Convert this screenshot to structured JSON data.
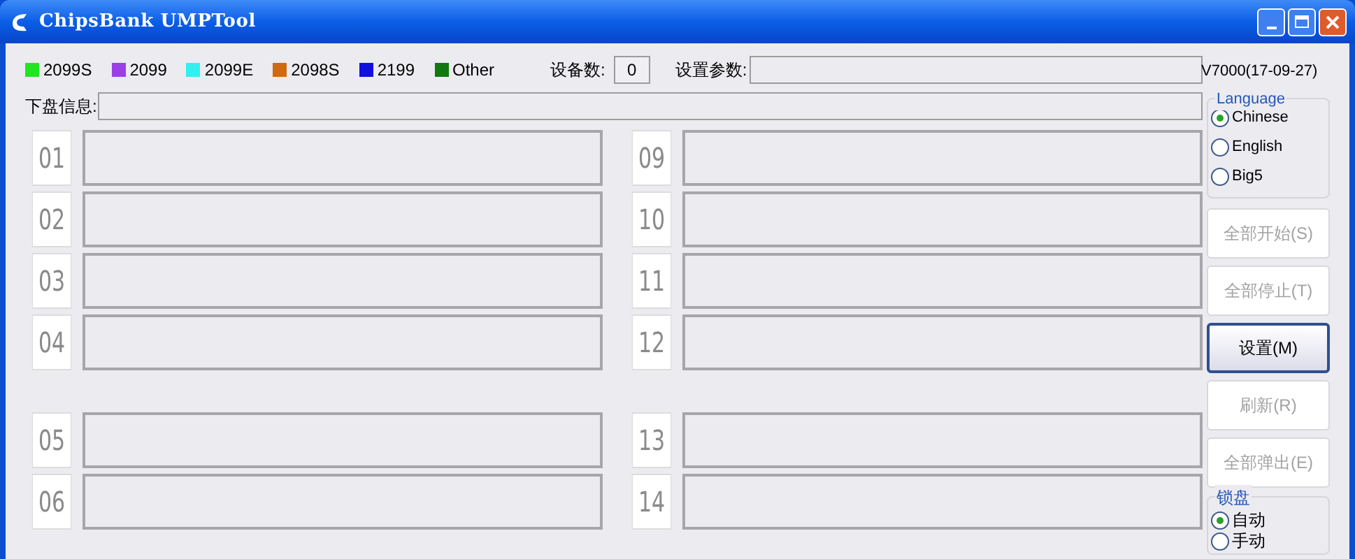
{
  "window": {
    "title": "ChipsBank UMPTool"
  },
  "legend": [
    {
      "label": "2099S",
      "color": "#22e522"
    },
    {
      "label": "2099",
      "color": "#9a40e6"
    },
    {
      "label": "2099E",
      "color": "#30f0f0"
    },
    {
      "label": "2098S",
      "color": "#d06a10"
    },
    {
      "label": "2199",
      "color": "#1010e0"
    },
    {
      "label": "Other",
      "color": "#107a10"
    }
  ],
  "device_count": {
    "label": "设备数:",
    "value": "0"
  },
  "settings_params": {
    "label": "设置参数:"
  },
  "version": "V7000(17-09-27)",
  "unload_info": {
    "label": "下盘信息:"
  },
  "slot_groups": [
    [
      {
        "number": "01"
      },
      {
        "number": "02"
      },
      {
        "number": "03"
      },
      {
        "number": "04"
      }
    ],
    [
      {
        "number": "09"
      },
      {
        "number": "10"
      },
      {
        "number": "11"
      },
      {
        "number": "12"
      }
    ],
    [
      {
        "number": "05"
      },
      {
        "number": "06"
      }
    ],
    [
      {
        "number": "13"
      },
      {
        "number": "14"
      }
    ]
  ],
  "language": {
    "title": "Language",
    "options": [
      {
        "label": "Chinese",
        "selected": true
      },
      {
        "label": "English",
        "selected": false
      },
      {
        "label": "Big5",
        "selected": false
      }
    ]
  },
  "buttons": [
    {
      "label": "全部开始(S)",
      "disabled": true
    },
    {
      "label": "全部停止(T)",
      "disabled": true
    },
    {
      "label": "设置(M)",
      "disabled": false
    },
    {
      "label": "刷新(R)",
      "disabled": true
    },
    {
      "label": "全部弹出(E)",
      "disabled": true
    }
  ],
  "lock_disk": {
    "title": "锁盘",
    "options": [
      {
        "label": "自动",
        "selected": true
      },
      {
        "label": "手动",
        "selected": false
      }
    ]
  }
}
